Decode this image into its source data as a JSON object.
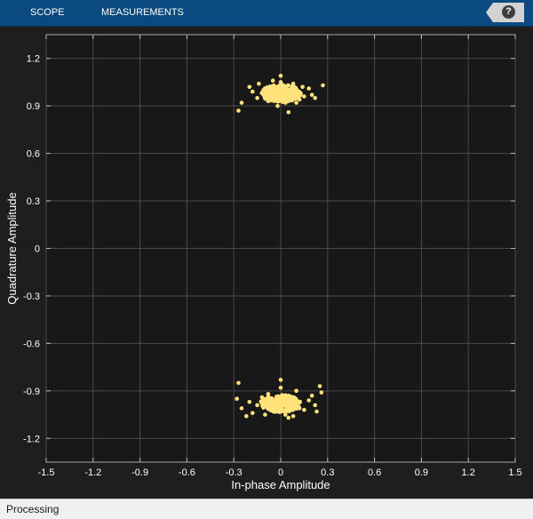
{
  "toolbar": {
    "tabs": [
      {
        "label": "SCOPE"
      },
      {
        "label": "MEASUREMENTS"
      }
    ],
    "help_label": "?"
  },
  "colors": {
    "plot_background": "#181818",
    "grid": "#4a4a4a",
    "samples": "#ffe27a",
    "toolbar": "#0b4a80",
    "axis_text": "#ffffff"
  },
  "chart_data": {
    "type": "scatter",
    "title": "",
    "xlabel": "In-phase Amplitude",
    "ylabel": "Quadrature Amplitude",
    "xlim": [
      -1.5,
      1.5
    ],
    "ylim": [
      -1.35,
      1.35
    ],
    "xticks": [
      -1.5,
      -1.2,
      -0.9,
      -0.6,
      -0.3,
      0,
      0.3,
      0.6,
      0.9,
      1.2,
      1.5
    ],
    "yticks": [
      1.2,
      0.9,
      0.6,
      0.3,
      0,
      -0.3,
      -0.6,
      -0.9,
      -1.2
    ],
    "grid": true,
    "series": [
      {
        "values_note": "",
        "points": [
          [
            0.0,
            0.98
          ],
          [
            0.05,
            1.0
          ],
          [
            -0.05,
            0.97
          ],
          [
            0.1,
            0.99
          ],
          [
            -0.1,
            1.01
          ],
          [
            0.15,
            0.96
          ],
          [
            -0.15,
            0.95
          ],
          [
            0.0,
            1.05
          ],
          [
            0.03,
            0.92
          ],
          [
            -0.02,
            0.9
          ],
          [
            0.2,
            0.97
          ],
          [
            -0.2,
            1.02
          ],
          [
            0.08,
            1.04
          ],
          [
            -0.08,
            0.93
          ],
          [
            0.12,
            0.94
          ],
          [
            -0.12,
            0.98
          ],
          [
            0.18,
            1.01
          ],
          [
            -0.18,
            0.99
          ],
          [
            0.22,
            0.95
          ],
          [
            0.27,
            1.03
          ],
          [
            -0.27,
            0.87
          ],
          [
            -0.25,
            0.92
          ],
          [
            0.05,
            0.86
          ],
          [
            0.0,
            1.09
          ],
          [
            -0.05,
            1.06
          ],
          [
            0.06,
            0.95
          ],
          [
            -0.07,
            0.99
          ],
          [
            0.1,
            0.92
          ],
          [
            0.14,
            1.02
          ],
          [
            -0.14,
            1.04
          ],
          [
            0.0,
            -0.98
          ],
          [
            0.05,
            -0.95
          ],
          [
            -0.05,
            -1.0
          ],
          [
            0.1,
            -0.97
          ],
          [
            -0.1,
            -0.96
          ],
          [
            0.15,
            -1.02
          ],
          [
            -0.15,
            -0.99
          ],
          [
            0.0,
            -0.88
          ],
          [
            0.03,
            -1.05
          ],
          [
            -0.02,
            -1.03
          ],
          [
            0.2,
            -0.93
          ],
          [
            -0.2,
            -0.97
          ],
          [
            0.08,
            -1.06
          ],
          [
            -0.08,
            -0.92
          ],
          [
            0.12,
            -1.01
          ],
          [
            -0.12,
            -0.94
          ],
          [
            0.18,
            -0.96
          ],
          [
            -0.18,
            -1.04
          ],
          [
            0.22,
            -0.99
          ],
          [
            0.26,
            -0.91
          ],
          [
            -0.28,
            -0.95
          ],
          [
            -0.27,
            -0.85
          ],
          [
            0.05,
            -1.07
          ],
          [
            0.0,
            -0.83
          ],
          [
            -0.22,
            -1.06
          ],
          [
            0.25,
            -0.87
          ],
          [
            0.23,
            -1.03
          ],
          [
            -0.1,
            -1.05
          ],
          [
            0.1,
            -0.9
          ],
          [
            -0.25,
            -1.01
          ]
        ]
      }
    ]
  },
  "status": {
    "text": "Processing"
  }
}
